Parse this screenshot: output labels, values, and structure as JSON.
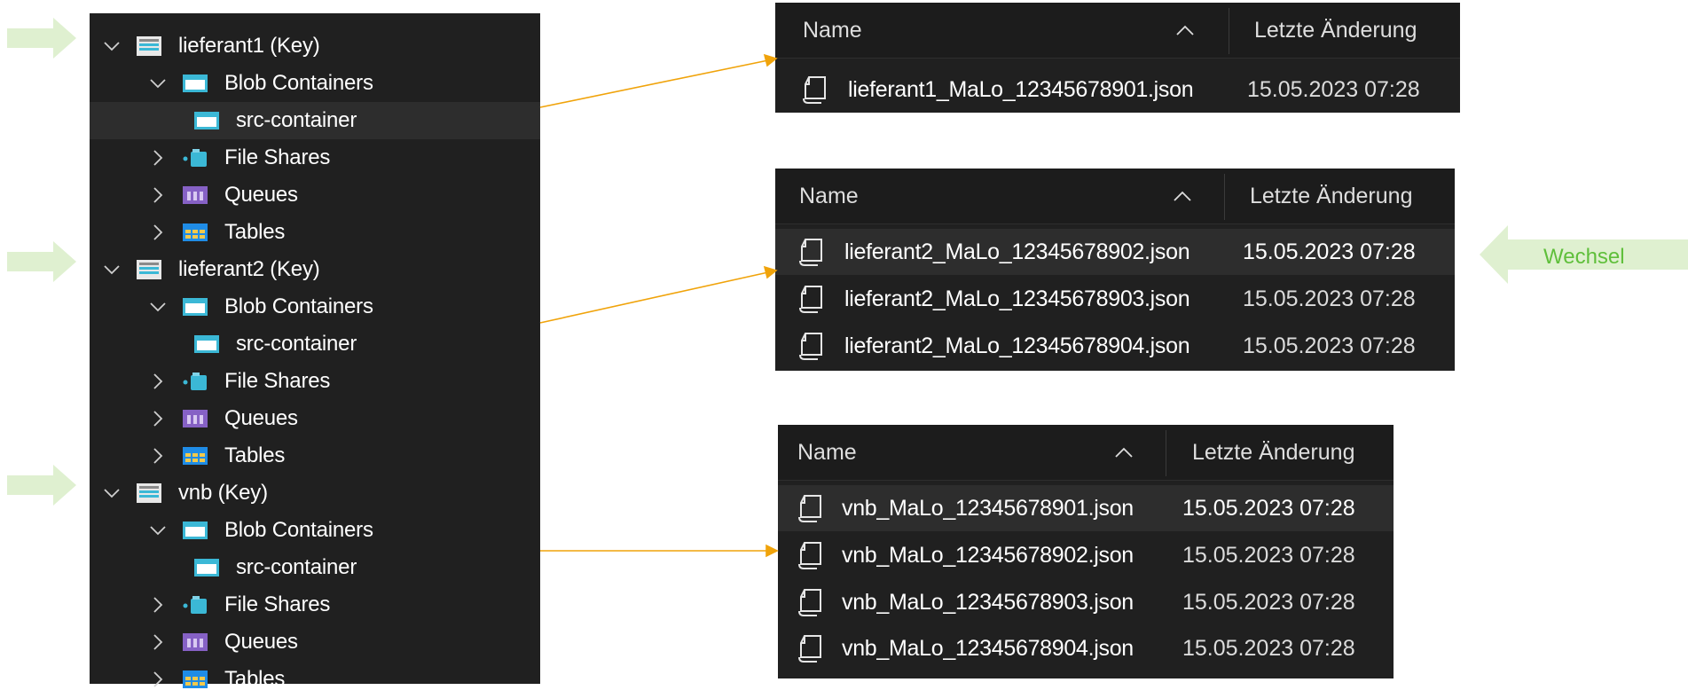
{
  "colors": {
    "panel_bg": "#202020",
    "header_bg": "#1c1c1c",
    "selected_row": "#2d2d2d",
    "connector_arrow": "#f0a30a",
    "pointer_arrow": "#dff0d0",
    "wechsel_text": "#5fbf3b",
    "storage_icon": "#3bb8d6",
    "queue_icon": "#8661c5",
    "table_icon": "#1f8ce6"
  },
  "tree": {
    "accounts": [
      {
        "label": "lieferant1 (Key)",
        "icon": "storage-account-icon",
        "children": [
          {
            "label": "Blob Containers",
            "icon": "blob-containers-icon",
            "expanded": true,
            "children": [
              {
                "label": "src-container",
                "icon": "container-icon",
                "selected": true
              }
            ]
          },
          {
            "label": "File Shares",
            "icon": "file-shares-icon"
          },
          {
            "label": "Queues",
            "icon": "queues-icon"
          },
          {
            "label": "Tables",
            "icon": "tables-icon"
          }
        ]
      },
      {
        "label": "lieferant2 (Key)",
        "icon": "storage-account-icon",
        "children": [
          {
            "label": "Blob Containers",
            "icon": "blob-containers-icon",
            "expanded": true,
            "children": [
              {
                "label": "src-container",
                "icon": "container-icon",
                "selected": false
              }
            ]
          },
          {
            "label": "File Shares",
            "icon": "file-shares-icon"
          },
          {
            "label": "Queues",
            "icon": "queues-icon"
          },
          {
            "label": "Tables",
            "icon": "tables-icon"
          }
        ]
      },
      {
        "label": "vnb (Key)",
        "icon": "storage-account-icon",
        "children": [
          {
            "label": "Blob Containers",
            "icon": "blob-containers-icon",
            "expanded": true,
            "children": [
              {
                "label": "src-container",
                "icon": "container-icon",
                "selected": false
              }
            ]
          },
          {
            "label": "File Shares",
            "icon": "file-shares-icon"
          },
          {
            "label": "Queues",
            "icon": "queues-icon"
          },
          {
            "label": "Tables",
            "icon": "tables-icon"
          }
        ]
      }
    ]
  },
  "panels": [
    {
      "columns": {
        "name": "Name",
        "date": "Letzte Änderung"
      },
      "files": [
        {
          "name": "lieferant1_MaLo_12345678901.json",
          "modified": "15.05.2023 07:28",
          "selected": false
        }
      ]
    },
    {
      "columns": {
        "name": "Name",
        "date": "Letzte Änderung"
      },
      "files": [
        {
          "name": "lieferant2_MaLo_12345678902.json",
          "modified": "15.05.2023 07:28",
          "selected": true
        },
        {
          "name": "lieferant2_MaLo_12345678903.json",
          "modified": "15.05.2023 07:28",
          "selected": false
        },
        {
          "name": "lieferant2_MaLo_12345678904.json",
          "modified": "15.05.2023 07:28",
          "selected": false
        }
      ]
    },
    {
      "columns": {
        "name": "Name",
        "date": "Letzte Änderung"
      },
      "files": [
        {
          "name": "vnb_MaLo_12345678901.json",
          "modified": "15.05.2023 07:28",
          "selected": true
        },
        {
          "name": "vnb_MaLo_12345678902.json",
          "modified": "15.05.2023 07:28",
          "selected": false
        },
        {
          "name": "vnb_MaLo_12345678903.json",
          "modified": "15.05.2023 07:28",
          "selected": false
        },
        {
          "name": "vnb_MaLo_12345678904.json",
          "modified": "15.05.2023 07:28",
          "selected": false
        }
      ]
    }
  ],
  "annotations": {
    "wechsel_label": "Wechsel"
  }
}
